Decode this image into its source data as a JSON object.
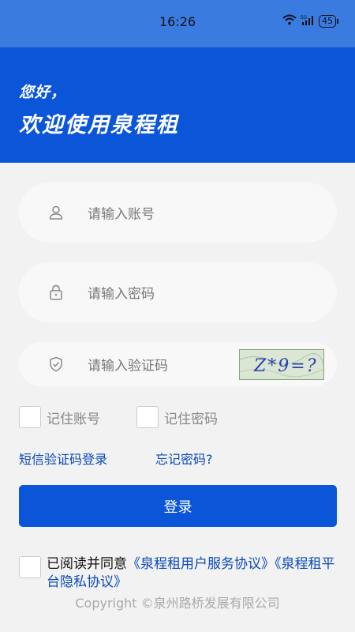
{
  "status_bar": {
    "time": "16:26",
    "battery": "45"
  },
  "header": {
    "greeting": "您好，",
    "welcome": "欢迎使用泉程租"
  },
  "form": {
    "account_placeholder": "请输入账号",
    "password_placeholder": "请输入密码",
    "captcha_placeholder": "请输入验证码",
    "captcha_text": "Z*9=?"
  },
  "options": {
    "remember_account": "记住账号",
    "remember_password": "记住密码"
  },
  "links": {
    "sms_login": "短信验证码登录",
    "forgot_password": "忘记密码?"
  },
  "login_button": "登录",
  "agreement": {
    "prefix": "已阅读并同意",
    "user_agreement": "《泉程租用户服务协议》",
    "privacy_agreement": "《泉程租平台隐私协议》"
  },
  "footer": {
    "copyright": "Copyright ©泉州路桥发展有限公司"
  },
  "colors": {
    "brand_blue": "#0a55d8",
    "link_blue": "#0b49b8",
    "status_bar": "#3a7be0",
    "background": "#f2f2f2"
  },
  "icons": [
    "wifi-icon",
    "signal-5g-icon",
    "battery-icon",
    "user-icon",
    "lock-icon",
    "shield-check-icon"
  ]
}
